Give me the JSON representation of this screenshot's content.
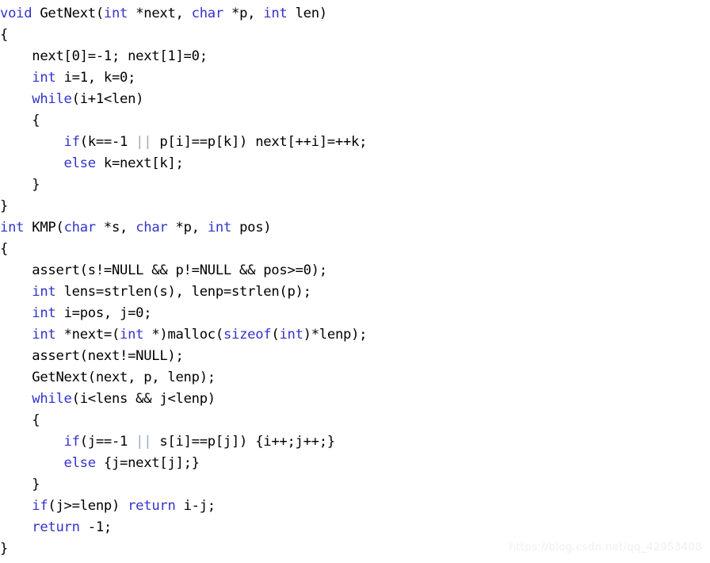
{
  "document": {
    "kind": "source-code-screenshot",
    "language": "C",
    "title": "KMP string matching implementation",
    "background_color": "#ffffff",
    "text_color": "#000000",
    "keyword_color": "#3333cc",
    "operator_color": "#9aa6c4",
    "watermark_color": "#f0f0f0",
    "font_size_px": 17,
    "line_height_px": 27,
    "indent_spaces": 4
  },
  "code": {
    "line_count": 26,
    "lines": [
      {
        "number": 1,
        "text": "void GetNext(int *next, char *p, int len)",
        "tokens": [
          {
            "t": "void",
            "c": "kw"
          },
          {
            "t": " GetNext(",
            "c": "pl"
          },
          {
            "t": "int",
            "c": "kw"
          },
          {
            "t": " *next, ",
            "c": "pl"
          },
          {
            "t": "char",
            "c": "kw"
          },
          {
            "t": " *p, ",
            "c": "pl"
          },
          {
            "t": "int",
            "c": "kw"
          },
          {
            "t": " len)",
            "c": "pl"
          }
        ]
      },
      {
        "number": 2,
        "text": "{",
        "tokens": [
          {
            "t": "{",
            "c": "pl"
          }
        ]
      },
      {
        "number": 3,
        "text": "    next[0]=-1; next[1]=0;",
        "tokens": [
          {
            "t": "    next[0]=-1; next[1]=0;",
            "c": "pl"
          }
        ]
      },
      {
        "number": 4,
        "text": "    int i=1, k=0;",
        "tokens": [
          {
            "t": "    ",
            "c": "pl"
          },
          {
            "t": "int",
            "c": "kw"
          },
          {
            "t": " i=1, k=0;",
            "c": "pl"
          }
        ]
      },
      {
        "number": 5,
        "text": "    while(i+1<len)",
        "tokens": [
          {
            "t": "    ",
            "c": "pl"
          },
          {
            "t": "while",
            "c": "kw"
          },
          {
            "t": "(i+1<len)",
            "c": "pl"
          }
        ]
      },
      {
        "number": 6,
        "text": "    {",
        "tokens": [
          {
            "t": "    {",
            "c": "pl"
          }
        ]
      },
      {
        "number": 7,
        "text": "        if(k==-1 || p[i]==p[k]) next[++i]=++k;",
        "tokens": [
          {
            "t": "        ",
            "c": "pl"
          },
          {
            "t": "if",
            "c": "kw"
          },
          {
            "t": "(k==-1 ",
            "c": "pl"
          },
          {
            "t": "||",
            "c": "op"
          },
          {
            "t": " p[i]==p[k]) next[++i]=++k;",
            "c": "pl"
          }
        ]
      },
      {
        "number": 8,
        "text": "        else k=next[k];",
        "tokens": [
          {
            "t": "        ",
            "c": "pl"
          },
          {
            "t": "else",
            "c": "kw"
          },
          {
            "t": " k=next[k];",
            "c": "pl"
          }
        ]
      },
      {
        "number": 9,
        "text": "    }",
        "tokens": [
          {
            "t": "    }",
            "c": "pl"
          }
        ]
      },
      {
        "number": 10,
        "text": "}",
        "tokens": [
          {
            "t": "}",
            "c": "pl"
          }
        ]
      },
      {
        "number": 11,
        "text": "int KMP(char *s, char *p, int pos)",
        "tokens": [
          {
            "t": "int",
            "c": "kw"
          },
          {
            "t": " KMP(",
            "c": "pl"
          },
          {
            "t": "char",
            "c": "kw"
          },
          {
            "t": " *s, ",
            "c": "pl"
          },
          {
            "t": "char",
            "c": "kw"
          },
          {
            "t": " *p, ",
            "c": "pl"
          },
          {
            "t": "int",
            "c": "kw"
          },
          {
            "t": " pos)",
            "c": "pl"
          }
        ]
      },
      {
        "number": 12,
        "text": "{",
        "tokens": [
          {
            "t": "{",
            "c": "pl"
          }
        ]
      },
      {
        "number": 13,
        "text": "    assert(s!=NULL && p!=NULL && pos>=0);",
        "tokens": [
          {
            "t": "    assert(s!=NULL && p!=NULL && pos>=0);",
            "c": "pl"
          }
        ]
      },
      {
        "number": 14,
        "text": "    int lens=strlen(s), lenp=strlen(p);",
        "tokens": [
          {
            "t": "    ",
            "c": "pl"
          },
          {
            "t": "int",
            "c": "kw"
          },
          {
            "t": " lens=strlen(s), lenp=strlen(p);",
            "c": "pl"
          }
        ]
      },
      {
        "number": 15,
        "text": "    int i=pos, j=0;",
        "tokens": [
          {
            "t": "    ",
            "c": "pl"
          },
          {
            "t": "int",
            "c": "kw"
          },
          {
            "t": " i=pos, j=0;",
            "c": "pl"
          }
        ]
      },
      {
        "number": 16,
        "text": "    int *next=(int *)malloc(sizeof(int)*lenp);",
        "tokens": [
          {
            "t": "    ",
            "c": "pl"
          },
          {
            "t": "int",
            "c": "kw"
          },
          {
            "t": " *next=(",
            "c": "pl"
          },
          {
            "t": "int",
            "c": "kw"
          },
          {
            "t": " *)malloc(",
            "c": "pl"
          },
          {
            "t": "sizeof",
            "c": "kw"
          },
          {
            "t": "(",
            "c": "pl"
          },
          {
            "t": "int",
            "c": "kw"
          },
          {
            "t": ")*lenp);",
            "c": "pl"
          }
        ]
      },
      {
        "number": 17,
        "text": "    assert(next!=NULL);",
        "tokens": [
          {
            "t": "    assert(next!=NULL);",
            "c": "pl"
          }
        ]
      },
      {
        "number": 18,
        "text": "    GetNext(next, p, lenp);",
        "tokens": [
          {
            "t": "    GetNext(next, p, lenp);",
            "c": "pl"
          }
        ]
      },
      {
        "number": 19,
        "text": "    while(i<lens && j<lenp)",
        "tokens": [
          {
            "t": "    ",
            "c": "pl"
          },
          {
            "t": "while",
            "c": "kw"
          },
          {
            "t": "(i<lens && j<lenp)",
            "c": "pl"
          }
        ]
      },
      {
        "number": 20,
        "text": "    {",
        "tokens": [
          {
            "t": "    {",
            "c": "pl"
          }
        ]
      },
      {
        "number": 21,
        "text": "        if(j==-1 || s[i]==p[j]) {i++;j++;}",
        "tokens": [
          {
            "t": "        ",
            "c": "pl"
          },
          {
            "t": "if",
            "c": "kw"
          },
          {
            "t": "(j==-1 ",
            "c": "pl"
          },
          {
            "t": "||",
            "c": "op"
          },
          {
            "t": " s[i]==p[j]) {i++;j++;}",
            "c": "pl"
          }
        ]
      },
      {
        "number": 22,
        "text": "        else {j=next[j];}",
        "tokens": [
          {
            "t": "        ",
            "c": "pl"
          },
          {
            "t": "else",
            "c": "kw"
          },
          {
            "t": " {j=next[j];}",
            "c": "pl"
          }
        ]
      },
      {
        "number": 23,
        "text": "    }",
        "tokens": [
          {
            "t": "    }",
            "c": "pl"
          }
        ]
      },
      {
        "number": 24,
        "text": "    if(j>=lenp) return i-j;",
        "tokens": [
          {
            "t": "    ",
            "c": "pl"
          },
          {
            "t": "if",
            "c": "kw"
          },
          {
            "t": "(j>=lenp) ",
            "c": "pl"
          },
          {
            "t": "return",
            "c": "kw"
          },
          {
            "t": " i-j;",
            "c": "pl"
          }
        ]
      },
      {
        "number": 25,
        "text": "    return -1;",
        "tokens": [
          {
            "t": "    ",
            "c": "pl"
          },
          {
            "t": "return",
            "c": "kw"
          },
          {
            "t": " -1;",
            "c": "pl"
          }
        ]
      },
      {
        "number": 26,
        "text": "}",
        "tokens": [
          {
            "t": "}",
            "c": "pl"
          }
        ]
      }
    ]
  },
  "watermark": {
    "text": "https://blog.csdn.net/qq_42953408"
  }
}
